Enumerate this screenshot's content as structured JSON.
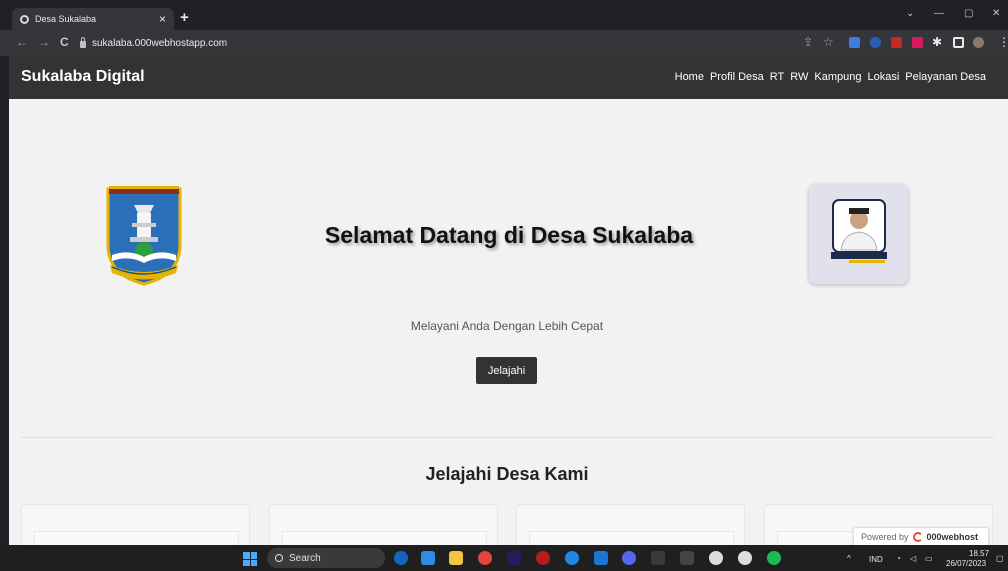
{
  "browser": {
    "tab_title": "Desa Sukalaba",
    "tab_close": "×",
    "new_tab": "+",
    "url": "sukalaba.000webhostapp.com",
    "window_controls": {
      "minimize": "—",
      "maximize": "▢",
      "close": "✕",
      "dropdown": "⌄"
    },
    "nav": {
      "back": "←",
      "forward": "→",
      "reload": "C"
    },
    "toolbar": {
      "share": "⇪",
      "bookmark": "☆",
      "extensions_label": "✱"
    }
  },
  "site": {
    "brand": "Sukalaba Digital",
    "nav": [
      "Home",
      "Profil Desa",
      "RT",
      "RW",
      "Kampung",
      "Lokasi",
      "Pelayanan Desa"
    ],
    "hero": {
      "title": "Selamat Datang di Desa Sukalaba",
      "subtitle": "Melayani Anda Dengan Lebih Cepat",
      "button": "Jelajahi"
    },
    "section_title": "Jelajahi Desa Kami",
    "webhost_badge": {
      "prefix": "Powered by",
      "brand": "000webhost"
    }
  },
  "taskbar": {
    "search_placeholder": "Search",
    "tray": {
      "language": "IND",
      "time": "18.57",
      "date": "26/07/2023"
    }
  },
  "colors": {
    "header_bg": "#333333",
    "page_bg": "#f2f2f2",
    "button_bg": "#333333"
  }
}
